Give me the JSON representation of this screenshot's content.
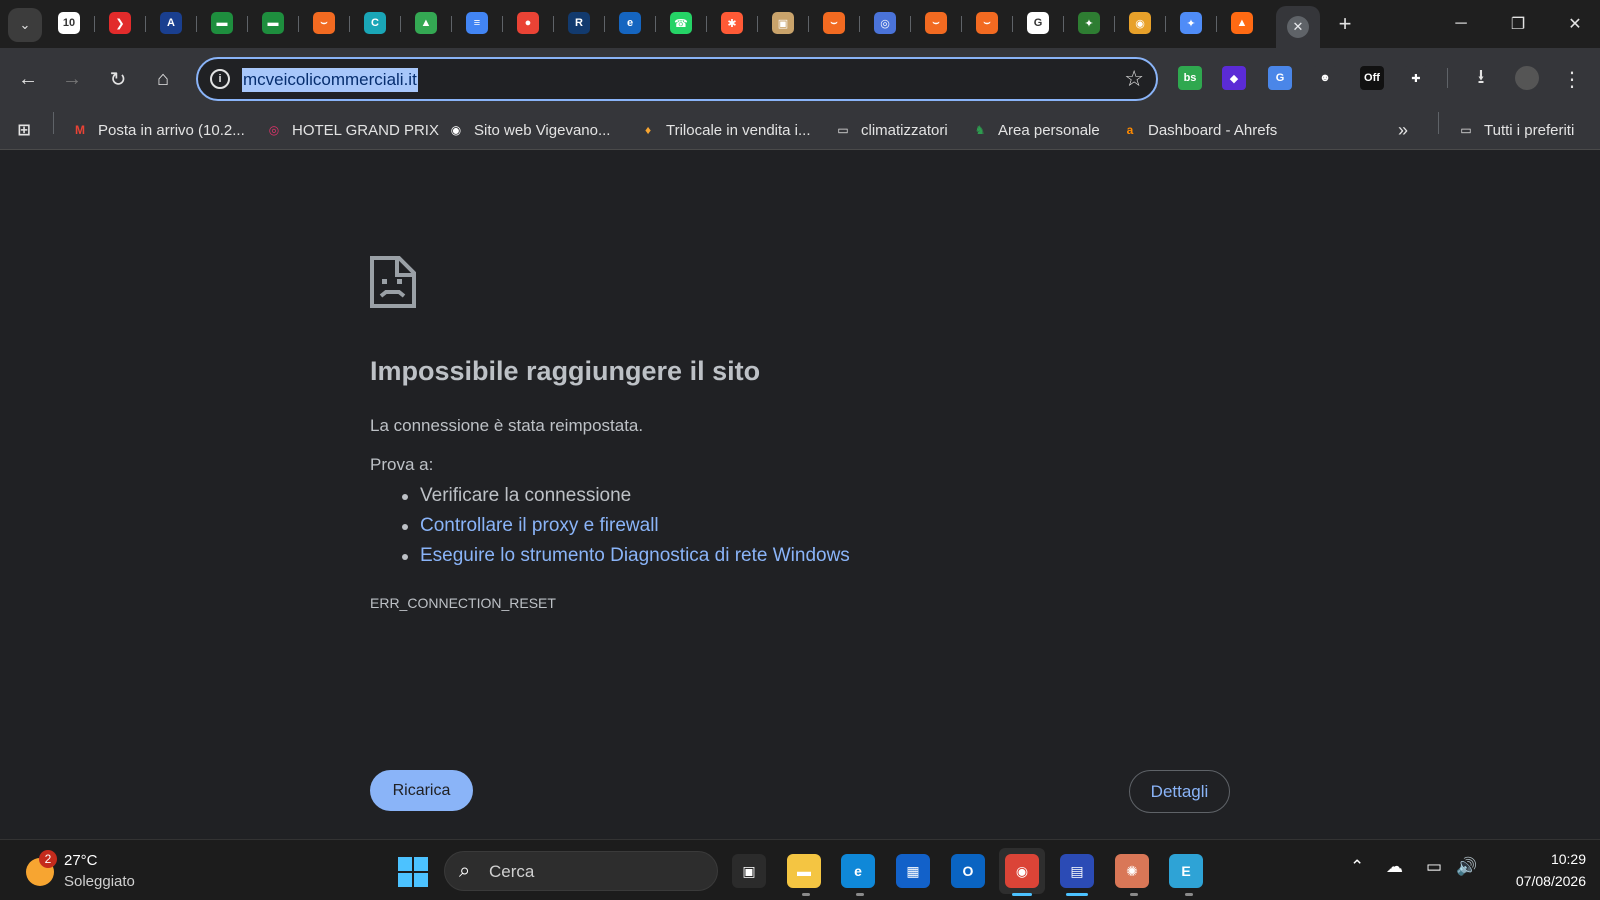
{
  "browser": {
    "pinned_tabs": [
      {
        "name": "calendar-tab-icon",
        "label": "10",
        "color": "#ffffff"
      },
      {
        "name": "red-logo-tab-icon",
        "label": "❯",
        "color": "#e22b2b"
      },
      {
        "name": "autohome-tab-icon",
        "label": "A",
        "color": "#1a3f8f"
      },
      {
        "name": "sheets-tab-icon",
        "label": "▬",
        "color": "#1e8e3e"
      },
      {
        "name": "sheets-tab-icon-2",
        "label": "▬",
        "color": "#1e8e3e"
      },
      {
        "name": "orange-tab-icon",
        "label": "⌣",
        "color": "#f26a21"
      },
      {
        "name": "teal-c-tab-icon",
        "label": "C",
        "color": "#1aa6b7"
      },
      {
        "name": "drive-tab-icon",
        "label": "▲",
        "color": "#34a853"
      },
      {
        "name": "docs-tab-icon",
        "label": "≡",
        "color": "#4285f4"
      },
      {
        "name": "maps-tab-icon",
        "label": "●",
        "color": "#ea4335"
      },
      {
        "name": "r-logo-tab-icon",
        "label": "R",
        "color": "#123a6e"
      },
      {
        "name": "blue-e-tab-icon",
        "label": "e",
        "color": "#1565c0"
      },
      {
        "name": "whatsapp-tab-icon",
        "label": "☎",
        "color": "#25d366"
      },
      {
        "name": "asterisk-tab-icon",
        "label": "✱",
        "color": "#ff5a36"
      },
      {
        "name": "photo-tab-icon",
        "label": "▣",
        "color": "#c9a36b"
      },
      {
        "name": "orange-tab-icon-2",
        "label": "⌣",
        "color": "#f26a21"
      },
      {
        "name": "ring-tab-icon",
        "label": "◎",
        "color": "#4a73d9"
      },
      {
        "name": "orange-tab-icon-3",
        "label": "⌣",
        "color": "#f26a21"
      },
      {
        "name": "orange-tab-icon-4",
        "label": "⌣",
        "color": "#f26a21"
      },
      {
        "name": "google-tab-icon",
        "label": "G",
        "color": "#ffffff"
      },
      {
        "name": "green-star-tab-icon",
        "label": "✦",
        "color": "#2e7d32"
      },
      {
        "name": "chrome-tab-icon",
        "label": "◉",
        "color": "#e8a12a"
      },
      {
        "name": "gemini-tab-icon",
        "label": "✦",
        "color": "#4f8cf7"
      },
      {
        "name": "ahrefs-tab-icon",
        "label": "▲",
        "color": "#ff6a13"
      }
    ],
    "active_tab_close": "✕",
    "new_tab": "+",
    "window": {
      "minimize": "─",
      "restore": "❐",
      "close": "✕"
    },
    "nav": {
      "back": "←",
      "forward": "→",
      "reload": "↻",
      "home": "⌂"
    },
    "omnibox": {
      "info": "i",
      "url": "mcveicolicommerciali.it",
      "star": "☆"
    },
    "extensions": [
      {
        "name": "bs-extension-icon",
        "label": "bs",
        "color": "#2fa84f"
      },
      {
        "name": "purple-extension-icon",
        "label": "◆",
        "color": "#5b2bd6"
      },
      {
        "name": "translate-extension-icon",
        "label": "G",
        "color": "#4a86e8"
      },
      {
        "name": "mask-extension-icon",
        "label": "☻",
        "color": "#35363a"
      },
      {
        "name": "off-extension-icon",
        "label": "Off",
        "color": "#111111"
      },
      {
        "name": "puzzle-extension-icon",
        "label": "✚",
        "color": "#35363a"
      }
    ],
    "download": "⭳",
    "menu": "⋮",
    "bookmarks": [
      {
        "name": "bookmark-gmail",
        "icon": "M",
        "icon_color": "#ea4335",
        "label": "Posta in arrivo (10.2..."
      },
      {
        "name": "bookmark-hotel",
        "icon": "◎",
        "icon_color": "#e2336b",
        "label": "HOTEL GRAND PRIX"
      },
      {
        "name": "bookmark-vigevano",
        "icon": "◉",
        "icon_color": "#ffffff",
        "label": "Sito web Vigevano..."
      },
      {
        "name": "bookmark-trilocale",
        "icon": "♦",
        "icon_color": "#f7a531",
        "label": "Trilocale in vendita i..."
      },
      {
        "name": "bookmark-climatizzatori",
        "icon": "▭",
        "icon_color": "#e3e3e3",
        "label": "climatizzatori"
      },
      {
        "name": "bookmark-area-personale",
        "icon": "♞",
        "icon_color": "#2e9c4f",
        "label": "Area personale"
      },
      {
        "name": "bookmark-ahrefs",
        "icon": "a",
        "icon_color": "#ff8a00",
        "label": "Dashboard - Ahrefs"
      }
    ],
    "bookmarks_more": "»",
    "all_bookmarks": "Tutti i preferiti"
  },
  "error_page": {
    "title": "Impossibile raggiungere il sito",
    "message": "La connessione è stata reimpostata.",
    "try_label": "Prova a:",
    "suggestions": [
      {
        "text": "Verificare la connessione",
        "link": false
      },
      {
        "text": "Controllare il proxy e firewall",
        "link": true
      },
      {
        "text": "Eseguire lo strumento Diagnostica di rete Windows",
        "link": true
      }
    ],
    "error_code": "ERR_CONNECTION_RESET",
    "reload_button": "Ricarica",
    "details_button": "Dettagli"
  },
  "taskbar": {
    "weather": {
      "badge": "2",
      "temp": "27°C",
      "desc": "Soleggiato"
    },
    "search_placeholder": "Cerca",
    "apps": [
      {
        "name": "task-view-icon",
        "label": "▣",
        "color": "#2b2b2b"
      },
      {
        "name": "file-explorer-icon",
        "label": "▬",
        "color": "#f4c542"
      },
      {
        "name": "edge-icon",
        "label": "e",
        "color": "#0f88d8"
      },
      {
        "name": "store-icon",
        "label": "▦",
        "color": "#1261c9"
      },
      {
        "name": "outlook-icon",
        "label": "O",
        "color": "#0a64c2"
      },
      {
        "name": "chrome-icon",
        "label": "◉",
        "color": "#db4437"
      },
      {
        "name": "save-app-icon",
        "label": "▤",
        "color": "#2b4bb5"
      },
      {
        "name": "claude-icon",
        "label": "✺",
        "color": "#d97757"
      },
      {
        "name": "e-app-icon",
        "label": "E",
        "color": "#2ea3d6"
      }
    ],
    "tray": {
      "chevron": "⌃",
      "onedrive": "☁",
      "network": "▭",
      "volume": "🔊"
    },
    "time": "10:29",
    "date": "07/08/2026"
  }
}
